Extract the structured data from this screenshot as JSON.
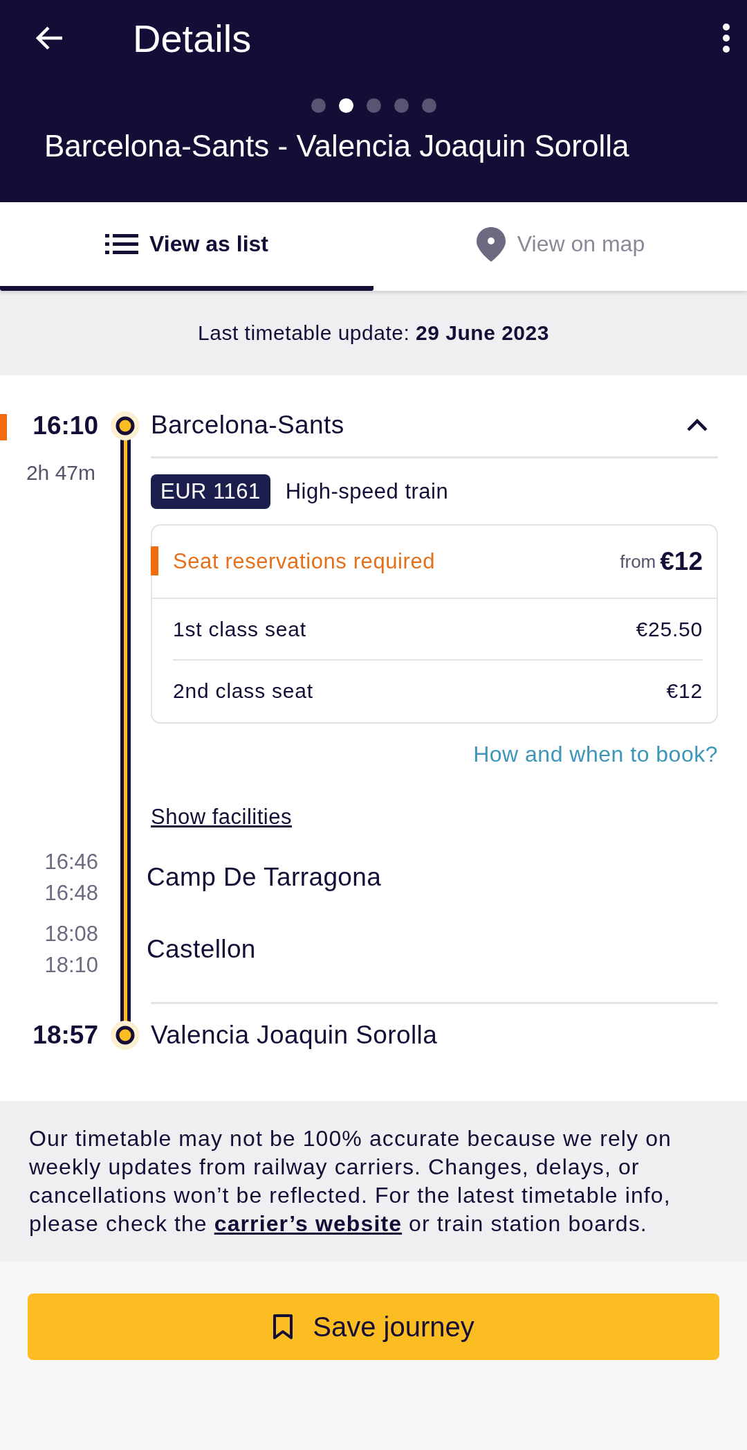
{
  "header": {
    "title": "Details",
    "route": "Barcelona-Sants - Valencia Joaquin Sorolla",
    "pager": [
      {
        "selected": false
      },
      {
        "selected": true
      },
      {
        "selected": false
      },
      {
        "selected": false
      },
      {
        "selected": false
      }
    ]
  },
  "tabs": [
    {
      "label": "View as list",
      "kind": "list",
      "selected": true
    },
    {
      "label": "View on map",
      "kind": "map",
      "selected": false
    }
  ],
  "update_notice": "Last timetable update: **29 June 2023**",
  "stops": [
    {
      "kind": "terminal",
      "time": "16:10",
      "name": "Barcelona-Sants",
      "highlighted": true,
      "expanded": true,
      "duration": "2h 47m",
      "train": {
        "number": "EUR 1161",
        "type": "High-speed train"
      },
      "reservation": {
        "label": "Seat reservations required",
        "required": true,
        "price_prefix": "from",
        "price": "€12",
        "classes": [
          {
            "name": "1st class seat",
            "price": "€25.50"
          },
          {
            "name": "2nd class seat",
            "price": "€12"
          }
        ]
      },
      "book_link": "How and when to book?",
      "facilities_link": "Show facilities"
    },
    {
      "kind": "intermediate",
      "arrival": "16:46",
      "departure": "16:48",
      "name": "Camp De Tarragona"
    },
    {
      "kind": "intermediate",
      "arrival": "18:08",
      "departure": "18:10",
      "name": "Castellon"
    },
    {
      "kind": "terminal",
      "time": "18:57",
      "name": "Valencia Joaquin Sorolla"
    }
  ],
  "disclaimer": {
    "before": "Our timetable may not be 100% accurate because we rely on weekly updates from railway carriers. Changes, delays, or cancellations won’t be reflected. For the latest timetable info, please check the ",
    "link": "carrier’s website",
    "after": " or train station boards."
  },
  "save_button": "Save journey"
}
